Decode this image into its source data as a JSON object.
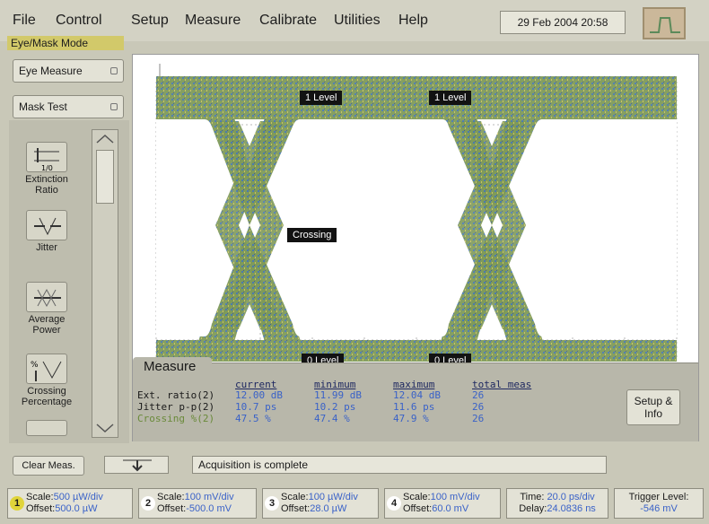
{
  "menu": {
    "file": "File",
    "control": "Control",
    "setup": "Setup",
    "measure": "Measure",
    "calibrate": "Calibrate",
    "utilities": "Utilities",
    "help": "Help"
  },
  "datetime": "29 Feb 2004   20:58",
  "mode_tab": "Eye/Mask Mode",
  "left_panel": {
    "eye_measure": "Eye Measure",
    "mask_test": "Mask Test",
    "items": [
      {
        "label": "Extinction Ratio",
        "icon": "extinction-ratio-icon"
      },
      {
        "label": "Jitter",
        "icon": "jitter-icon"
      },
      {
        "label": "Average Power",
        "icon": "average-power-icon"
      },
      {
        "label": "Crossing Percentage",
        "icon": "crossing-percentage-icon"
      }
    ]
  },
  "display": {
    "labels": {
      "level1_left": "1 Level",
      "level1_right": "1 Level",
      "crossing": "Crossing",
      "level0_left": "0 Level",
      "level0_right": "0 Level"
    }
  },
  "measure": {
    "tab": "Measure",
    "headers": [
      "current",
      "minimum",
      "maximum",
      "total meas"
    ],
    "rows": [
      {
        "label": "Ext. ratio(2)",
        "current": "12.00 dB",
        "minimum": "11.99 dB",
        "maximum": "12.04 dB",
        "total": "26"
      },
      {
        "label": "Jitter p-p(2)",
        "current": "10.7 ps",
        "minimum": "10.2 ps",
        "maximum": "11.6 ps",
        "total": "26"
      },
      {
        "label": "Crossing %(2)",
        "current": "47.5 %",
        "minimum": "47.4 %",
        "maximum": "47.9 %",
        "total": "26"
      }
    ],
    "setup_info": "Setup & Info"
  },
  "bottom": {
    "clear_meas": "Clear Meas.",
    "status": "Acquisition is complete"
  },
  "channels": [
    {
      "num": "1",
      "color": "#e0d43a",
      "scale_label": "Scale:",
      "scale": "500 µW/div",
      "offset_label": "Offset:",
      "offset": "500.0 µW"
    },
    {
      "num": "2",
      "color": "#ffffff",
      "scale_label": "Scale:",
      "scale": "100 mV/div",
      "offset_label": "Offset:",
      "offset": "-500.0 mV"
    },
    {
      "num": "3",
      "color": "#ffffff",
      "scale_label": "Scale:",
      "scale": "100 µW/div",
      "offset_label": "Offset:",
      "offset": "28.0 µW"
    },
    {
      "num": "4",
      "color": "#ffffff",
      "scale_label": "Scale:",
      "scale": "100 mV/div",
      "offset_label": "Offset:",
      "offset": "60.0 mV"
    }
  ],
  "timebase": {
    "time_label": "Time:",
    "time": "20.0 ps/div",
    "delay_label": "Delay:",
    "delay": "24.0836 ns"
  },
  "trigger": {
    "label": "Trigger Level:",
    "value": "-546 mV"
  }
}
